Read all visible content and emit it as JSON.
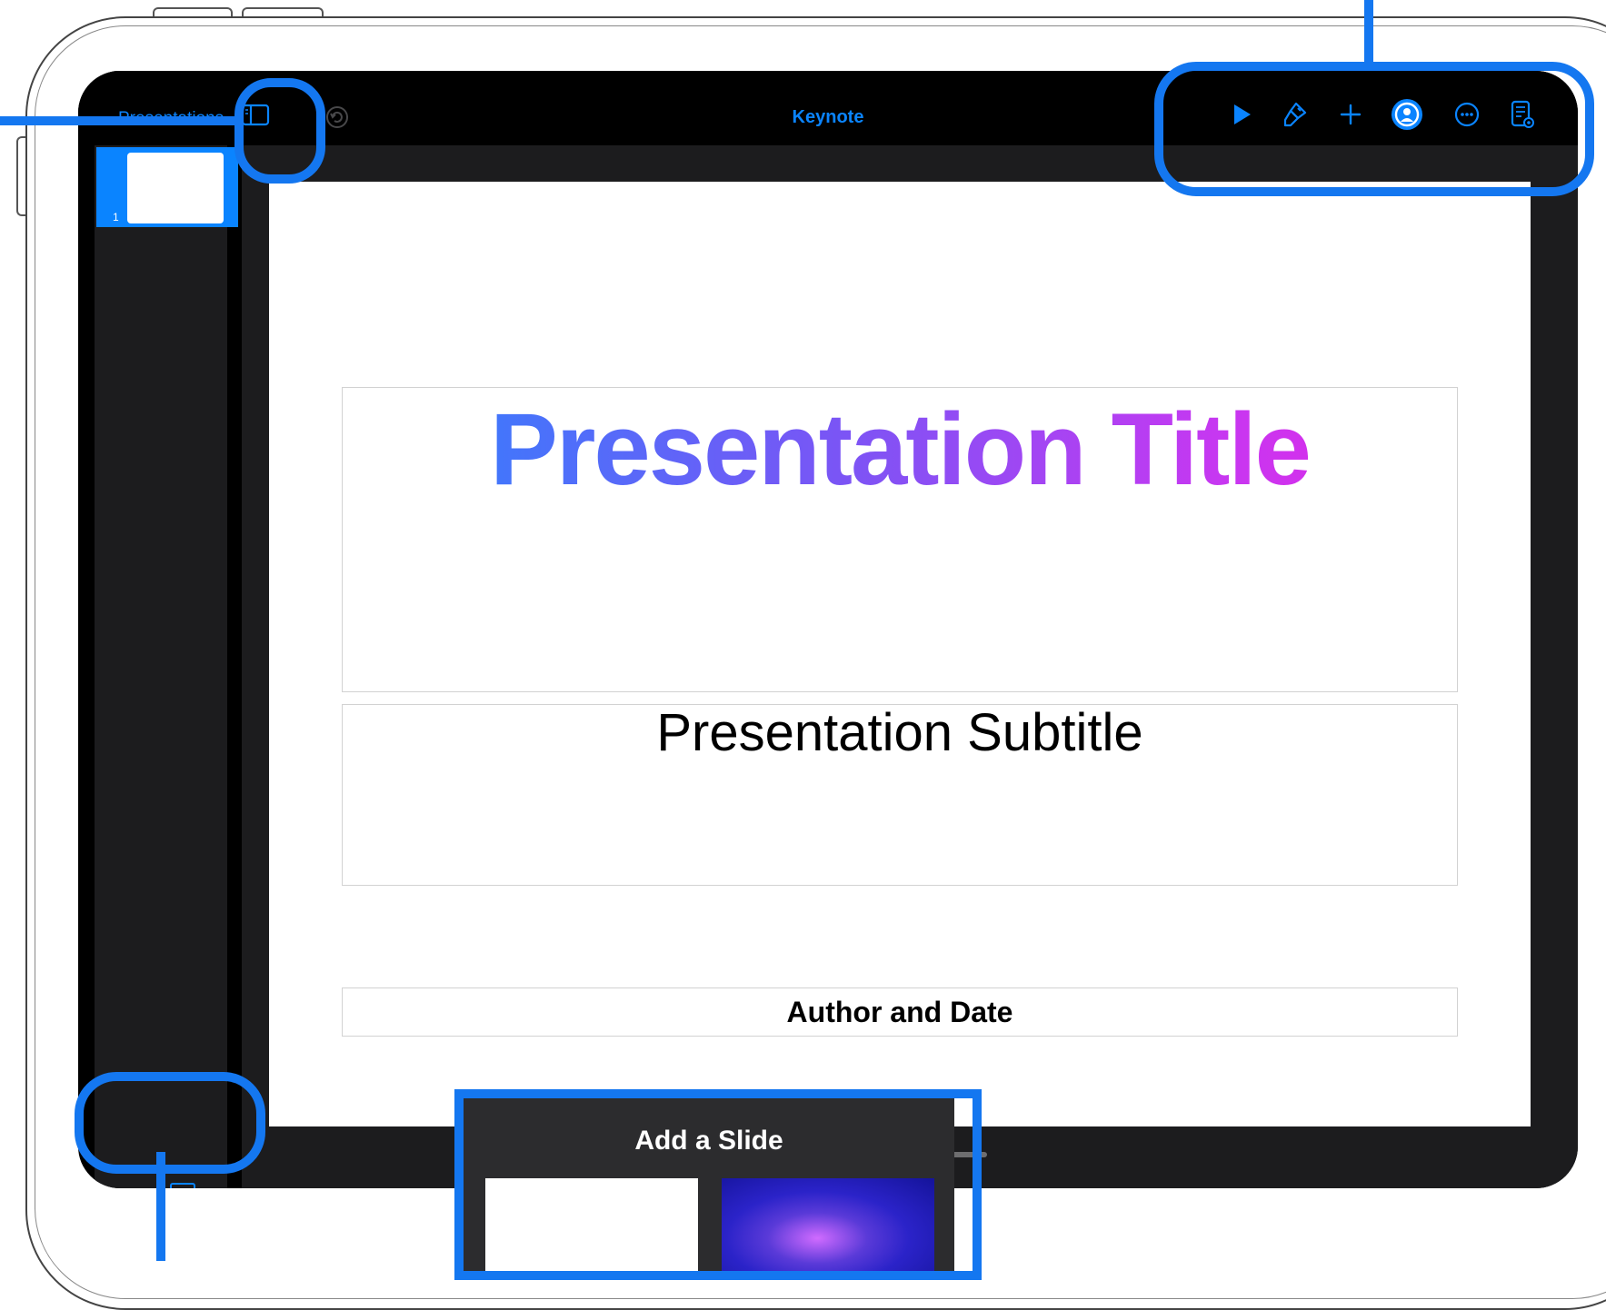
{
  "toolbar": {
    "back_label": "Presentations",
    "app_title": "Keynote",
    "icons": [
      "sidebar-icon",
      "undo-icon",
      "play-icon",
      "format-brush-icon",
      "plus-icon",
      "collaborate-icon",
      "more-icon",
      "presenter-notes-icon"
    ]
  },
  "navigator": {
    "slides": [
      {
        "number": "1"
      }
    ]
  },
  "slide": {
    "title": "Presentation Title",
    "subtitle": "Presentation Subtitle",
    "author": "Author and Date",
    "title_gradient": [
      "#1f8bff",
      "#7a55f5",
      "#c638f1",
      "#ee1fe3"
    ]
  },
  "add_slide_sheet": {
    "title": "Add a Slide"
  },
  "colors": {
    "accent": "#0a84ff",
    "highlight": "#1477f0",
    "screen_bg": "#000000",
    "panel_bg": "#1c1c1e"
  }
}
